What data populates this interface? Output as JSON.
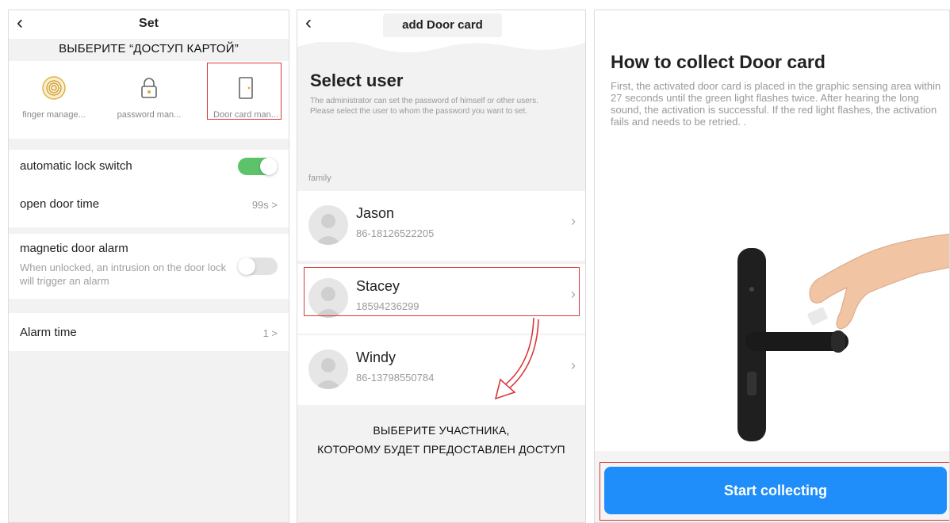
{
  "panel1": {
    "title": "Set",
    "annotation": "Выберите “Доступ картой”",
    "features": [
      {
        "label": "finger manage...",
        "icon": "fingerprint-icon"
      },
      {
        "label": "password man...",
        "icon": "lock-icon"
      },
      {
        "label": "Door card man...",
        "icon": "door-icon"
      }
    ],
    "auto_lock": {
      "label": "automatic lock switch",
      "state": "on"
    },
    "open_door_time": {
      "label": "open door time",
      "value": "99s >"
    },
    "magnetic_alarm": {
      "label": "magnetic door alarm",
      "description": "When unlocked, an intrusion on the door lock will trigger an alarm",
      "state": "off"
    },
    "alarm_time": {
      "label": "Alarm time",
      "value": "1 >"
    }
  },
  "panel2": {
    "title": "add Door card",
    "heading": "Select user",
    "description": "The administrator can set the password of himself or other users. Please select the user to whom the password you want to set.",
    "section_label": "family",
    "users": [
      {
        "name": "Jason",
        "phone": "86-18126522205"
      },
      {
        "name": "Stacey",
        "phone": "18594236299"
      },
      {
        "name": "Windy",
        "phone": "86-13798550784"
      }
    ],
    "annotation_line1": "Выберите участника,",
    "annotation_line2": "которому будет предоставлен доступ"
  },
  "panel3": {
    "heading": "How to collect Door card",
    "body": "First, the activated door card is placed in the graphic sensing area within 27 seconds until the green light flashes twice. After hearing the long sound, the activation is successful. If the red light flashes, the activation fails and needs to be retried. .",
    "button_label": "Start collecting"
  },
  "colors": {
    "toggle_on": "#5cc36b",
    "primary_button": "#1f8efa",
    "highlight_box": "#d9393a"
  }
}
